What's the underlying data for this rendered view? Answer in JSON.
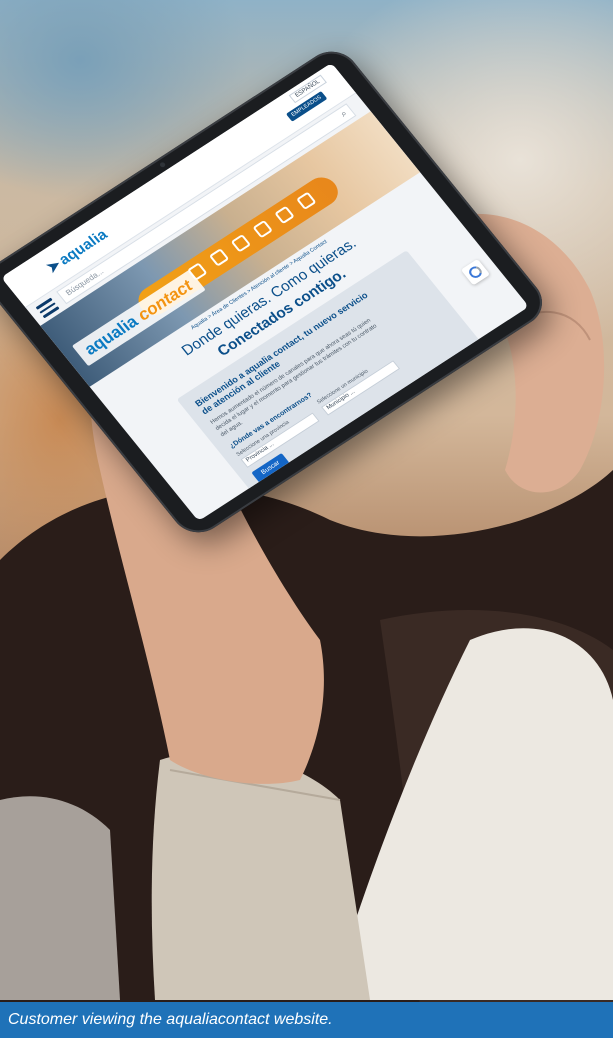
{
  "caption": "Customer viewing the aqualiacontact website.",
  "screen": {
    "lang": "ESPAÑOL",
    "employee_badge": "EMPLEADOS",
    "logo": "aqualia",
    "menu_icon": "hamburger-menu-icon",
    "search_placeholder": "Búsqueda...",
    "search_icon": "magnifier-icon",
    "hero_brand_main": "aqualia",
    "hero_brand_accent": "contact",
    "breadcrumb": "Aqualia  >  Área de Clientes  >  Atención al cliente  >  Aqualia Contact",
    "headline": "Donde quieras. Como quieras.",
    "subheadline": "Conectados contigo.",
    "card": {
      "title": "Bienvenido a aqualia contact, tu nuevo servicio de atención al cliente",
      "body": "Hemos aumentado el número de canales para que ahora seas tú quien decida el lugar y el momento para gestionar tus trámites con tu contrato del agua.",
      "question": "¿Dónde vas a encontrarnos?",
      "province_label": "Seleccione una provincia",
      "municipality_label": "Seleccione un municipio",
      "province_value": "Provincia ...",
      "municipality_value": "Municipio ...",
      "button": "Buscar"
    },
    "recaptcha_icon": "recaptcha-icon"
  },
  "colors": {
    "brand_blue": "#0a7ac2",
    "brand_orange": "#f39412",
    "caption_bar": "#1f72b8",
    "button": "#1466c6"
  }
}
